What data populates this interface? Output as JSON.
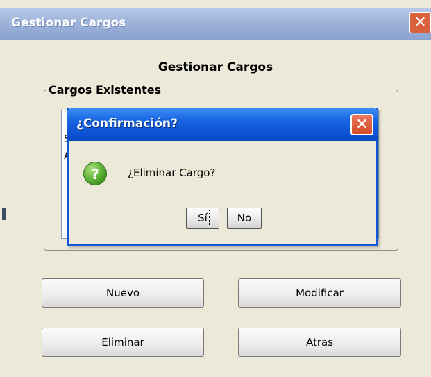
{
  "window": {
    "title": "Gestionar Cargos",
    "close_glyph": "✕"
  },
  "main": {
    "heading": "Gestionar Cargos",
    "group_label": "Cargos Existentes",
    "list_items": [
      "S",
      "A"
    ],
    "buttons": {
      "nuevo": "Nuevo",
      "modificar": "Modificar",
      "eliminar": "Eliminar",
      "atras": "Atras"
    }
  },
  "dialog": {
    "title": "¿Confirmación?",
    "close_glyph": "✕",
    "icon": "question-icon",
    "icon_glyph": "?",
    "message": "¿Eliminar Cargo?",
    "yes_label": "Sí",
    "no_label": "No"
  },
  "colors": {
    "dialog_title": "#0c4fd0",
    "close_button": "#d64a26",
    "window_bg": "#ece9d8"
  }
}
